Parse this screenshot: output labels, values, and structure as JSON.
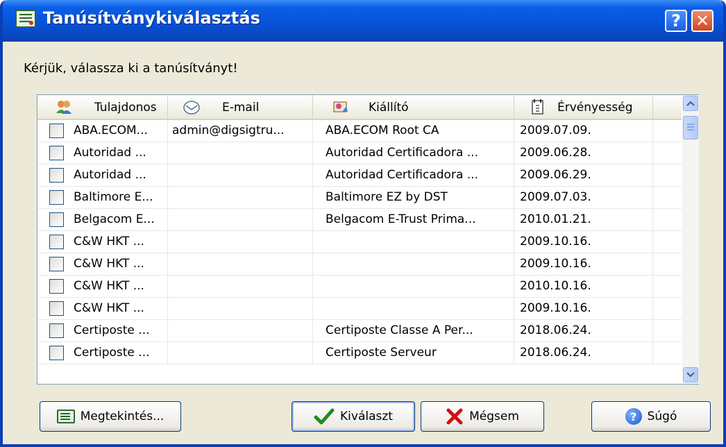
{
  "window": {
    "title": "Tanúsítványkiválasztás",
    "help_glyph": "?",
    "close_glyph": "✕"
  },
  "prompt": "Kérjük, válassza ki a tanúsítványt!",
  "columns": [
    {
      "label": "Tulajdonos",
      "icon": "users-icon"
    },
    {
      "label": "E-mail",
      "icon": "envelope-icon"
    },
    {
      "label": "Kiállító",
      "icon": "issuer-icon"
    },
    {
      "label": "Érvényesség",
      "icon": "calendar-icon"
    }
  ],
  "rows": [
    {
      "owner": "ABA.ECOM...",
      "email": "admin@digsigtru...",
      "issuer": "ABA.ECOM Root CA",
      "validity": "2009.07.09."
    },
    {
      "owner": "Autoridad ...",
      "email": "",
      "issuer": "Autoridad Certificadora ...",
      "validity": "2009.06.28."
    },
    {
      "owner": "Autoridad ...",
      "email": "",
      "issuer": "Autoridad Certificadora ...",
      "validity": "2009.06.29."
    },
    {
      "owner": "Baltimore E...",
      "email": "",
      "issuer": "Baltimore EZ by DST",
      "validity": "2009.07.03."
    },
    {
      "owner": "Belgacom E...",
      "email": "",
      "issuer": "Belgacom E-Trust Prima...",
      "validity": "2010.01.21."
    },
    {
      "owner": "C&W HKT ...",
      "email": "",
      "issuer": "",
      "validity": "2009.10.16."
    },
    {
      "owner": "C&W HKT ...",
      "email": "",
      "issuer": "",
      "validity": "2009.10.16."
    },
    {
      "owner": "C&W HKT ...",
      "email": "",
      "issuer": "",
      "validity": "2010.10.16."
    },
    {
      "owner": "C&W HKT ...",
      "email": "",
      "issuer": "",
      "validity": "2009.10.16."
    },
    {
      "owner": "Certiposte ...",
      "email": "",
      "issuer": "Certiposte Classe A Per...",
      "validity": "2018.06.24."
    },
    {
      "owner": "Certiposte ...",
      "email": "",
      "issuer": "Certiposte Serveur",
      "validity": "2018.06.24."
    }
  ],
  "buttons": {
    "view": "Megtekintés...",
    "select": "Kiválaszt",
    "cancel": "Mégsem",
    "help": "Súgó",
    "help_glyph": "?"
  },
  "colors": {
    "titlebar": "#0753d8",
    "dialog_bg": "#ece9d8",
    "check_green": "#1f8a1f",
    "cancel_red": "#cc1111"
  }
}
